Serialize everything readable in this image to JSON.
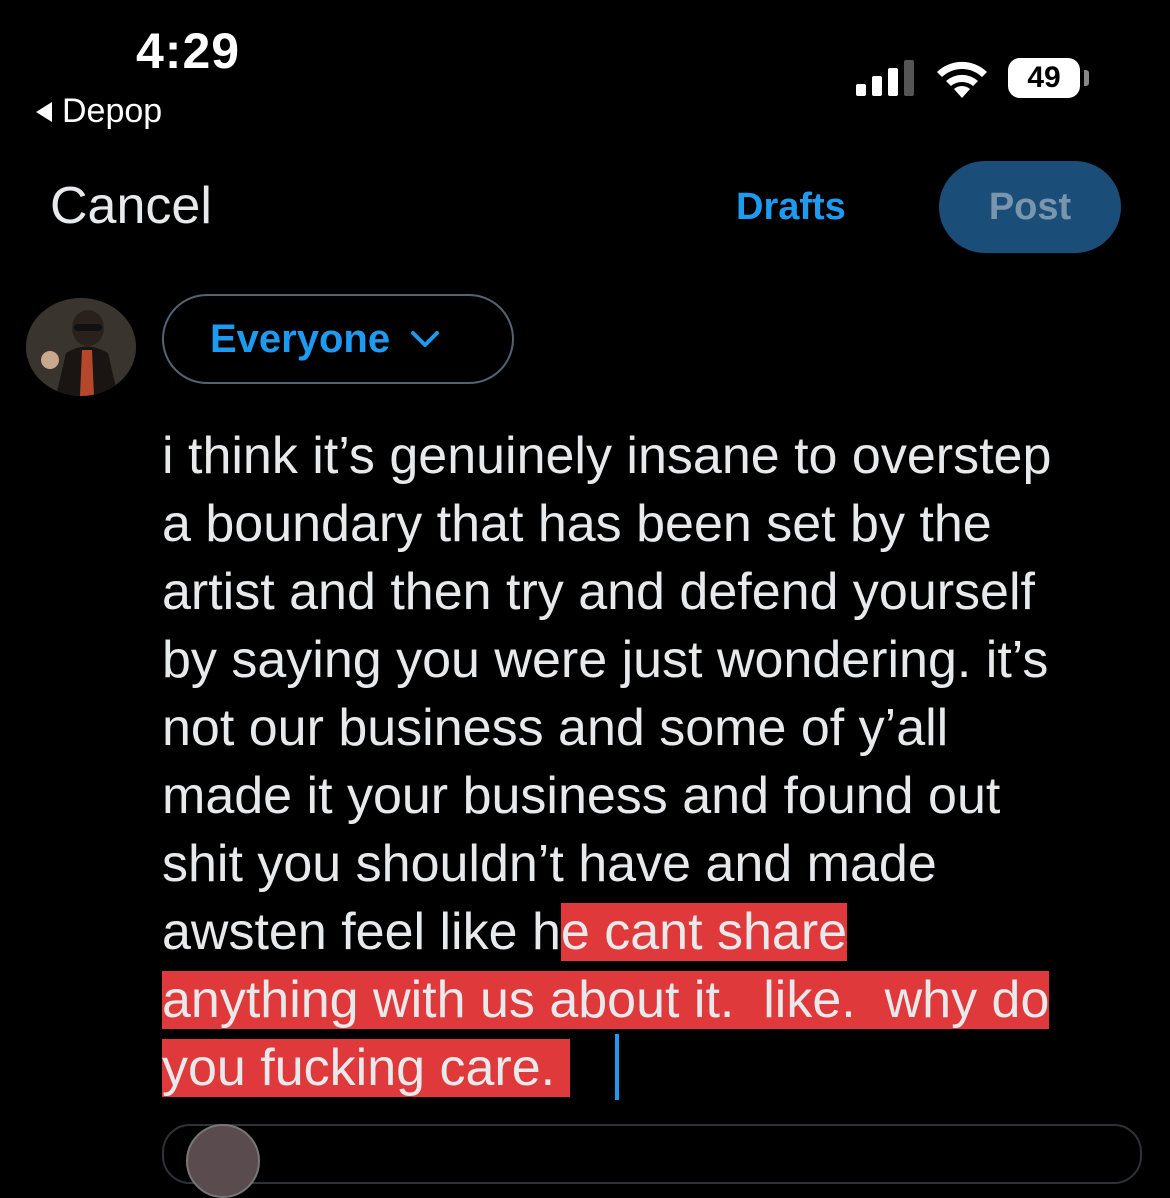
{
  "status_bar": {
    "time": "4:29",
    "back_app": "Depop",
    "battery": "49"
  },
  "toolbar": {
    "cancel_label": "Cancel",
    "drafts_label": "Drafts",
    "post_label": "Post"
  },
  "audience": {
    "label": "Everyone"
  },
  "tweet": {
    "lines": [
      {
        "plain": "i think it’s genuinely insane to overstep",
        "highlighted": ""
      },
      {
        "plain": "a boundary that has been set by the",
        "highlighted": ""
      },
      {
        "plain": "artist and then try and defend yourself",
        "highlighted": ""
      },
      {
        "plain": "by saying you were just wondering. it’s",
        "highlighted": ""
      },
      {
        "plain": "not our business and some of y’all",
        "highlighted": ""
      },
      {
        "plain": "made it your business and found out",
        "highlighted": ""
      },
      {
        "plain": "shit you shouldn’t have and made",
        "highlighted": ""
      },
      {
        "plain": "awsten feel like h",
        "highlighted": "e cant share"
      },
      {
        "plain": "",
        "highlighted": "anything with us about it.  like.  why do"
      },
      {
        "plain": "",
        "highlighted": "you fucking care. "
      }
    ]
  },
  "colors": {
    "accent": "#1d9bf0",
    "highlight": "#e0393b",
    "post_button": "#1a4e79",
    "background": "#000000"
  },
  "icons": [
    "back-arrow-icon",
    "cellular-signal-icon",
    "wifi-icon",
    "battery-icon",
    "chevron-down-icon",
    "avatar"
  ]
}
